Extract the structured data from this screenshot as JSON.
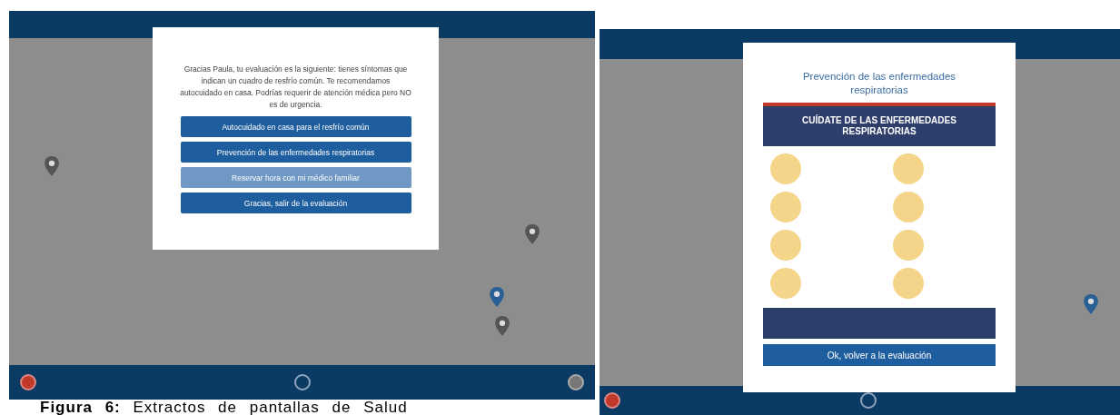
{
  "screens": [
    {
      "kind": "evaluation",
      "dialog": {
        "message": "Gracias Paula, tu evaluación es la siguiente: tienes síntomas que indican un cuadro de resfrío común. Te recomendamos autocuidado en casa. Podrías requerir de atención médica pero NO es de urgencia.",
        "buttons": [
          {
            "label": "Autocuidado en casa para el resfrío común",
            "disabled": false
          },
          {
            "label": "Prevención de las enfermedades respiratorias",
            "disabled": false
          },
          {
            "label": "Reservar hora con mi médico familiar",
            "disabled": true
          },
          {
            "label": "Gracias, salir de la evaluación",
            "disabled": false
          }
        ]
      }
    },
    {
      "kind": "prevention",
      "dialog": {
        "title": "Prevención de las enfermedades respiratorias",
        "banner": "CUÍDATE DE LAS ENFERMEDADES RESPIRATORIAS",
        "button": "Ok, volver a la evaluación"
      }
    }
  ],
  "caption": "**Figura 6:** Extractos de pantallas de Salud"
}
